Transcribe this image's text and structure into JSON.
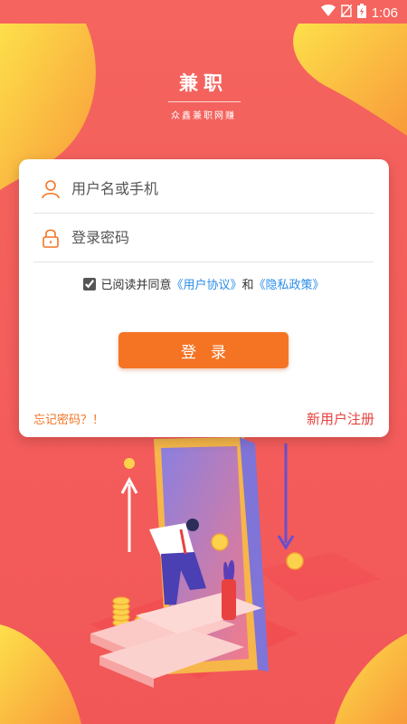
{
  "status_bar": {
    "time": "1:06"
  },
  "header": {
    "title": "兼职",
    "subtitle": "众鑫兼职网赚"
  },
  "form": {
    "username_placeholder": "用户名或手机",
    "password_placeholder": "登录密码",
    "agree_prefix": "已阅读并同意",
    "user_agreement": "《用户协议》",
    "agree_and": "和",
    "privacy_policy": "《隐私政策》",
    "agree_checked": true,
    "login_label": "登录",
    "forgot_password": "忘记密码？！",
    "register": "新用户注册"
  },
  "colors": {
    "background": "#f45f5f",
    "accent_orange": "#f57423",
    "link_blue": "#2a8de8",
    "register_red": "#e8413f",
    "blob_yellow": "#fcc33d"
  },
  "icons": [
    "wifi-icon",
    "no-sim-icon",
    "battery-icon",
    "user-icon",
    "lock-icon"
  ]
}
